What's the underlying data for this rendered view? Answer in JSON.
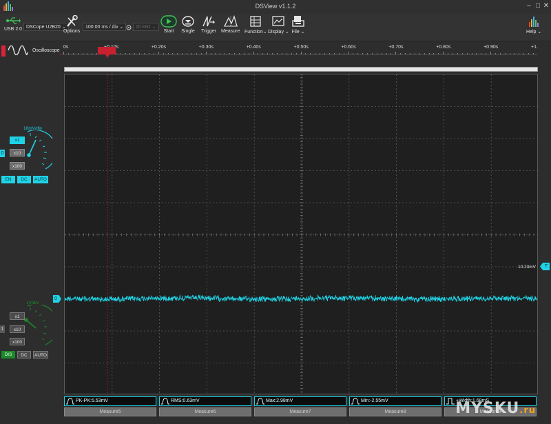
{
  "window": {
    "title": "DSView v1.1.2",
    "minimize": "–",
    "maximize": "□",
    "close": "✕"
  },
  "toolbar": {
    "device_label": "USB 2.0",
    "device_name": "DSCope U2B20",
    "options_label": "Options",
    "timebase": "100.00 ms / div",
    "sample_rate": "20 kHz",
    "start_label": "Start",
    "single_label": "Single",
    "trigger_label": "Trigger",
    "measure_label": "Measure",
    "function_label": "Function",
    "display_label": "Display",
    "file_label": "File",
    "help_label": "Help"
  },
  "mode": {
    "label": "Oscilloscope"
  },
  "ruler": {
    "ticks": [
      "0s",
      "+0.10s",
      "+0.20s",
      "+0.30s",
      "+0.40s",
      "+0.50s",
      "+0.60s",
      "+0.70s",
      "+0.80s",
      "+0.90s",
      "+1."
    ]
  },
  "channel0": {
    "vdiv": "10mV/div",
    "x1": "x1",
    "x10": "x10",
    "x100": "x100",
    "en": "EN",
    "dc": "DC",
    "auto": "AUTO",
    "marker": "0",
    "color": "#1fd3e6"
  },
  "channel1": {
    "vdiv": "1V/div",
    "x1": "x1",
    "x10": "x10",
    "x100": "x100",
    "dis": "DIS",
    "dc": "DC",
    "auto": "AUTO",
    "marker": "1",
    "color": "#1c8a2c"
  },
  "scope": {
    "trigger_level": "10.23mV",
    "trigger_marker": "T",
    "grid_color": "#5c5c5c",
    "trace_color": "#1fd3e6"
  },
  "measurements": [
    {
      "text": "PK-PK:5.53mV",
      "icon": "pulse-icon"
    },
    {
      "text": "RMS:0.63mV",
      "icon": "pulse-icon"
    },
    {
      "text": "Max:2.98mV",
      "icon": "pulse-icon"
    },
    {
      "text": "Min:-2.55mV",
      "icon": "pulse-icon"
    },
    {
      "text": "+Width:1.68mS",
      "icon": "square-pulse-icon"
    }
  ],
  "measure_slots": [
    "Measure5",
    "Measure6",
    "Measure7",
    "Measure8",
    "Measure9"
  ],
  "watermark": {
    "brand": "MYSKU",
    "tld": ".ru"
  }
}
